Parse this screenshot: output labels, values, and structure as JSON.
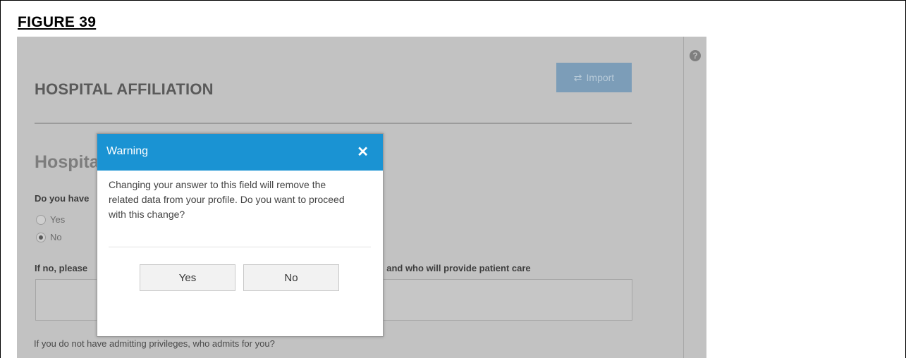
{
  "figure": {
    "title": "FIGURE 39"
  },
  "page": {
    "import_label": "Import",
    "section_title": "HOSPITAL AFFILIATION",
    "subsection_title_visible": "Hospita",
    "question_visible": "Do you have",
    "radio_options": [
      {
        "label": "Yes",
        "selected": false
      },
      {
        "label": "No",
        "selected": true
      }
    ],
    "ifno_left_visible": "If no, please",
    "ifno_right_visible": "l and who will provide patient care",
    "admits_question": "If you do not have admitting privileges, who admits for you?"
  },
  "modal": {
    "title": "Warning",
    "close_glyph": "✕",
    "body_lines": [
      "Changing your answer to this field will remove the",
      "related data from your profile. Do you want to proceed",
      "with this change?"
    ],
    "yes_label": "Yes",
    "no_label": "No"
  },
  "colors": {
    "modal_header": "#1a93d3",
    "import_button": "#7c9db8",
    "overlay_background": "#c2c2c2"
  }
}
